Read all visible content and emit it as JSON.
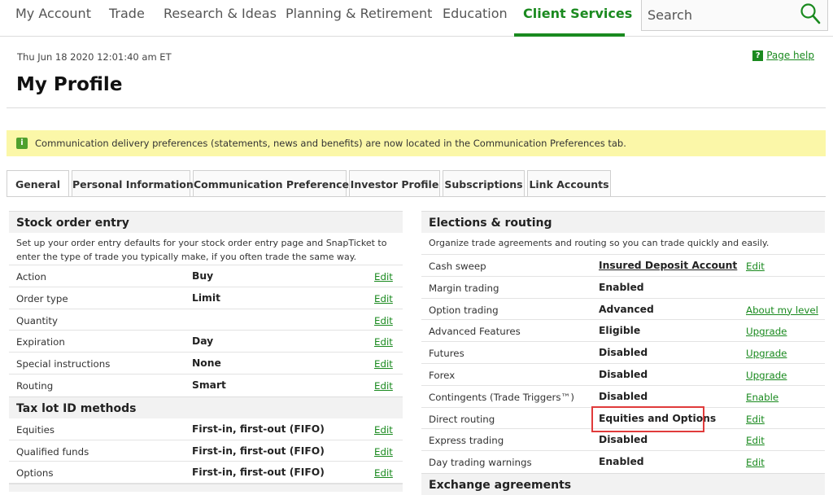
{
  "nav": {
    "items": [
      {
        "label": "My Account"
      },
      {
        "label": "Trade"
      },
      {
        "label": "Research & Ideas"
      },
      {
        "label": "Planning & Retirement"
      },
      {
        "label": "Education"
      },
      {
        "label": "Client Services"
      }
    ],
    "active_color": "#1a8a1f",
    "search": {
      "placeholder": "Search",
      "icon": "search-icon"
    }
  },
  "header": {
    "timestamp": "Thu Jun 18 2020 12:01:40 am ET",
    "page_help": "Page help",
    "help_icon": "?",
    "title": "My Profile"
  },
  "banner": {
    "icon": "info-icon",
    "text": "Communication delivery preferences (statements, news and benefits) are now located in the Communication Preferences tab.",
    "color": "#fbf7a8"
  },
  "tabs": [
    {
      "label": "General",
      "active": true
    },
    {
      "label": "Personal Information"
    },
    {
      "label": "Communication Preferences"
    },
    {
      "label": "Investor Profile"
    },
    {
      "label": "Subscriptions"
    },
    {
      "label": "Link Accounts"
    }
  ],
  "stock_order_entry": {
    "title": "Stock order entry",
    "description": "Set up your order entry defaults for your stock order entry page and SnapTicket to enter the type of trade you typically make, if you often trade the same way.",
    "rows": [
      {
        "label": "Action",
        "value": "Buy",
        "action": "Edit"
      },
      {
        "label": "Order type",
        "value": "Limit",
        "action": "Edit"
      },
      {
        "label": "Quantity",
        "value": "",
        "action": "Edit"
      },
      {
        "label": "Expiration",
        "value": "Day",
        "action": "Edit"
      },
      {
        "label": "Special instructions",
        "value": "None",
        "action": "Edit"
      },
      {
        "label": "Routing",
        "value": "Smart",
        "action": "Edit"
      }
    ]
  },
  "tax_lot": {
    "title": "Tax lot ID methods",
    "rows": [
      {
        "label": "Equities",
        "value": "First-in, first-out (FIFO)",
        "action": "Edit"
      },
      {
        "label": "Qualified funds",
        "value": "First-in, first-out (FIFO)",
        "action": "Edit"
      },
      {
        "label": "Options",
        "value": "First-in, first-out (FIFO)",
        "action": "Edit"
      }
    ]
  },
  "elections": {
    "title": "Elections & routing",
    "description": "Organize trade agreements and routing so you can trade quickly and easily.",
    "rows": [
      {
        "label": "Cash sweep",
        "value": "Insured Deposit Account",
        "action": "Edit"
      },
      {
        "label": "Margin trading",
        "value": "Enabled",
        "action": ""
      },
      {
        "label": "Option trading",
        "value": "Advanced",
        "action": "About my level"
      },
      {
        "label": "Advanced Features",
        "value": "Eligible",
        "action": "Upgrade"
      },
      {
        "label": "Futures",
        "value": "Disabled",
        "action": "Upgrade"
      },
      {
        "label": "Forex",
        "value": "Disabled",
        "action": "Upgrade"
      },
      {
        "label": "Contingents (Trade Triggers™)",
        "value": "Disabled",
        "action": "Enable"
      },
      {
        "label": "Direct routing",
        "value": "Equities and Options",
        "action": "Edit"
      },
      {
        "label": "Express trading",
        "value": "Disabled",
        "action": "Edit"
      },
      {
        "label": "Day trading warnings",
        "value": "Enabled",
        "action": "Edit"
      }
    ]
  },
  "exchange": {
    "title": "Exchange agreements"
  },
  "highlight_color": "#e03b3b"
}
